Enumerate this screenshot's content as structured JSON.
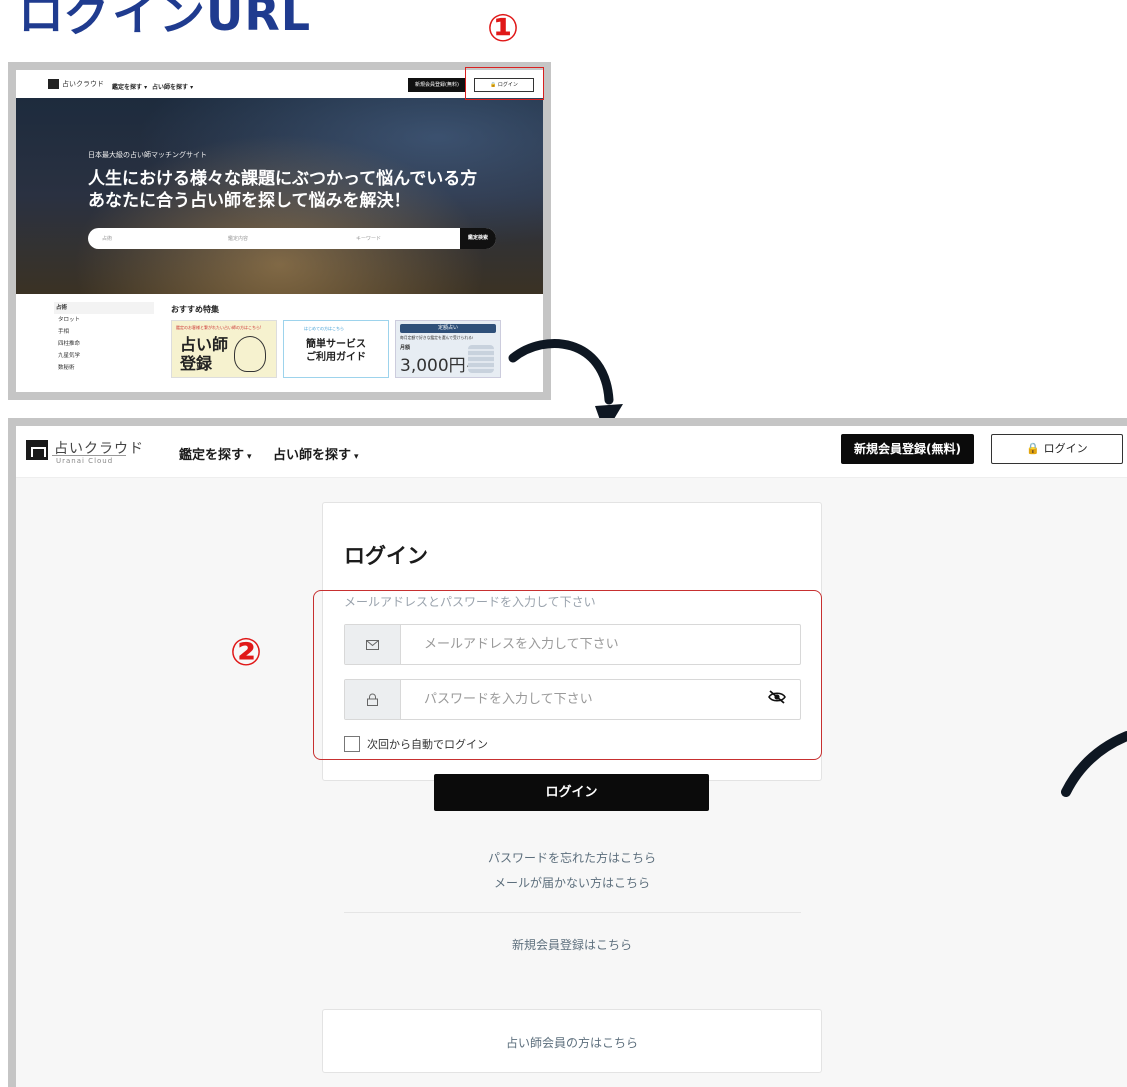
{
  "page_heading": "ログインURL",
  "markers": {
    "one": "①",
    "two": "②"
  },
  "colors": {
    "heading": "#1f3b8f",
    "marker": "#e01818",
    "primary_button": "#0b0b0b",
    "link": "#5d6f7d"
  },
  "top_screenshot": {
    "logo": "占いクラウド",
    "nav": [
      "鑑定を探す ▾",
      "占い師を探す ▾"
    ],
    "register_button": "新規会員登録(無料)",
    "login_button": "🔒 ログイン",
    "hero_subtitle": "日本最大級の占い師マッチングサイト",
    "hero_line1": "人生における様々な課題にぶつかって悩んでいる方",
    "hero_line2": "あなたに合う占い師を探して悩みを解決！",
    "search_fields": [
      "占術",
      "鑑定内容",
      "キーワード"
    ],
    "search_button": "鑑定検索",
    "sidebar_head": "占術",
    "sidebar_items": [
      "タロット",
      "手相",
      "四柱推命",
      "九星気学",
      "数秘術"
    ],
    "featured_title": "おすすめ特集",
    "card1_small": "鑑定のお客様と繋がれたい占い師の方はこちら!",
    "card1_big": "占い師\n登録",
    "card2_small": "はじめての方はこちら",
    "card2_big": "簡単サービス\nご利用ガイド",
    "card3_bar": "定額占い",
    "card3_small": "毎月定額で好きな鑑定を選んで受けられる!",
    "card3_month": "月額",
    "card3_price": "3,000円~"
  },
  "navbar": {
    "logo_jp": "占いクラウド",
    "logo_en": "Uranai Cloud",
    "nav_links": [
      "鑑定を探す",
      "占い師を探す"
    ],
    "caret": "▾",
    "register_button": "新規会員登録(無料)",
    "login_button": "🔒 ログイン"
  },
  "login_form": {
    "title": "ログイン",
    "instruction": "メールアドレスとパスワードを入力して下さい",
    "email_icon": "envelope-icon",
    "email_placeholder": "メールアドレスを入力して下さい",
    "email_value": "",
    "password_icon": "lock-icon",
    "password_placeholder": "パスワードを入力して下さい",
    "password_value": "",
    "toggle_icon": "eye-slash-icon",
    "remember_label": "次回から自動でログイン",
    "remember_checked": false,
    "submit_label": "ログイン",
    "forgot_password_link": "パスワードを忘れた方はこちら",
    "no_email_link": "メールが届かない方はこちら",
    "register_link": "新規会員登録はこちら",
    "fortune_teller_link": "占い師会員の方はこちら"
  }
}
